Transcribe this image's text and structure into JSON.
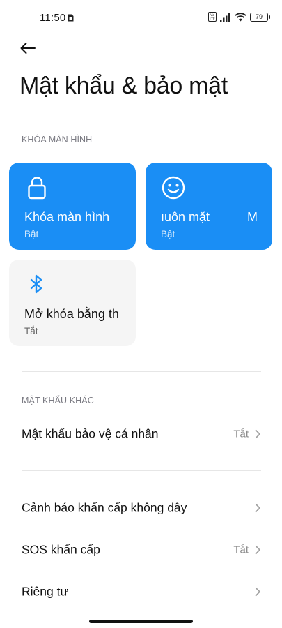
{
  "status_bar": {
    "time": "11:50",
    "battery": "79",
    "icons": [
      "sim-card-icon",
      "volte-icon",
      "signal-icon",
      "wifi-icon",
      "battery-icon"
    ]
  },
  "header": {
    "back_icon": "arrow-left-icon",
    "title": "Mật khẩu & bảo mật"
  },
  "screen_lock_section": {
    "header": "KHÓA MÀN HÌNH",
    "tiles": [
      {
        "icon": "lock-icon",
        "title": "Khóa màn hình",
        "status": "Bật",
        "active": true,
        "color": "#1a8ef5"
      },
      {
        "icon": "face-icon",
        "title": "ıuôn mặt",
        "title_overflow": "M",
        "status": "Bật",
        "active": true,
        "color": "#1a8ef5"
      },
      {
        "icon": "bluetooth-icon",
        "title": "Mở khóa bằng th",
        "status": "Tắt",
        "active": false,
        "color": "#f5f5f5"
      }
    ]
  },
  "other_passwords_section": {
    "header": "MẬT KHẨU KHÁC",
    "items": [
      {
        "label": "Mật khẩu bảo vệ cá nhân",
        "value": "Tắt"
      }
    ]
  },
  "more_items": [
    {
      "label": "Cảnh báo khẩn cấp không dây",
      "value": ""
    },
    {
      "label": "SOS khẩn cấp",
      "value": "Tắt"
    },
    {
      "label": "Riêng tư",
      "value": ""
    }
  ],
  "colors": {
    "accent": "#1a8ef5",
    "tile_inactive": "#f5f5f5",
    "section_header": "#7a7a82",
    "value_text": "#8a8a8a"
  }
}
